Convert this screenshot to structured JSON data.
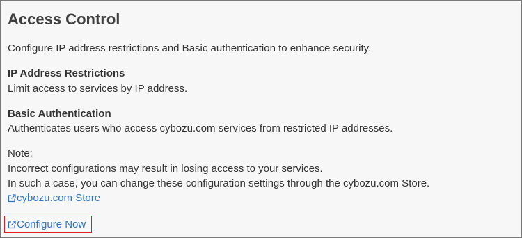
{
  "section": {
    "title": "Access Control",
    "intro": "Configure IP address restrictions and Basic authentication to enhance security."
  },
  "ip_restrictions": {
    "heading": "IP Address Restrictions",
    "description": "Limit access to services by IP address."
  },
  "basic_auth": {
    "heading": "Basic Authentication",
    "description": "Authenticates users who access cybozu.com services from restricted IP addresses."
  },
  "note": {
    "label": "Note:",
    "line1": "Incorrect configurations may result in losing access to your services.",
    "line2": "In such a case, you can change these configuration settings through the cybozu.com Store."
  },
  "links": {
    "store_label": "cybozu.com Store",
    "configure_label": "Configure Now",
    "icon": "external-link-icon"
  },
  "colors": {
    "link": "#2f73c5",
    "highlight_border": "#e02020",
    "panel_background": "#f7f7f7",
    "panel_border": "#7a7a7a"
  }
}
